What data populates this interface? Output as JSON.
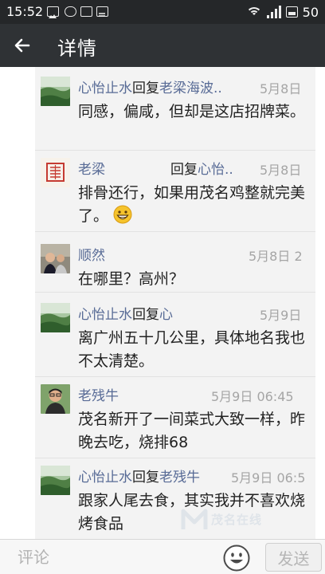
{
  "status_bar": {
    "time": "15:52",
    "battery": "50",
    "icons": [
      "image-icon",
      "cloud-icon",
      "lock-icon",
      "notes-icon",
      "wifi-icon",
      "signal-icon",
      "battery-icon"
    ]
  },
  "header": {
    "back_icon": "arrow-left-icon",
    "title": "详情"
  },
  "comments": [
    {
      "name": "心怡止水",
      "reply_word": "回复",
      "target": "老梁海波..",
      "time": "5月8日",
      "text": "同感，偏咸，但却是这店招牌菜。"
    },
    {
      "name": "老梁",
      "reply_word": "回复",
      "target": "心怡..",
      "time": "5月8日",
      "text": "排骨还行，如果用茂名鸡整就完美了。",
      "emoji": "grinning-face"
    },
    {
      "name": "顺然",
      "reply_word": "",
      "target": "",
      "time": "5月8日 2",
      "text": "在哪里？高州？"
    },
    {
      "name": "心怡止水",
      "reply_word": "回复",
      "target": "心",
      "time": "5月9日",
      "text": "离广州五十几公里，具体地名我也不太清楚。"
    },
    {
      "name": "老残牛",
      "reply_word": "",
      "target": "",
      "time": "5月9日 06:45",
      "text": "茂名新开了一间菜式大致一样，昨晚去吃，烧排68"
    },
    {
      "name": "心怡止水",
      "reply_word": "回复",
      "target": "老残牛",
      "time": "5月9日 06:5",
      "text": "跟家人尾去食，其实我并不喜欢烧烤食品"
    }
  ],
  "watermark": "茂名在线",
  "input_bar": {
    "placeholder": "评论",
    "emoji_button": "smiley-icon",
    "send_label": "发送"
  },
  "colors": {
    "status_bar": "#252729",
    "title_bar": "#2f3235",
    "link_name": "#586b96",
    "timestamp": "#a5a5a5",
    "panel": "#f3f3f3"
  }
}
